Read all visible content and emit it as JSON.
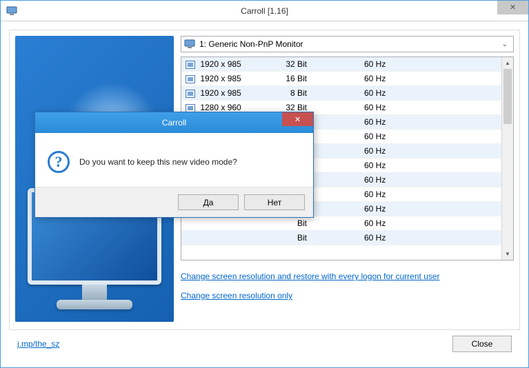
{
  "window": {
    "title": "Carroll [1.16]"
  },
  "monitor_select": {
    "selected": "1: Generic Non-PnP Monitor"
  },
  "resolutions": [
    {
      "res": "1920 x 985",
      "bit": "32 Bit",
      "hz": "60 Hz"
    },
    {
      "res": "1920 x 985",
      "bit": "16 Bit",
      "hz": "60 Hz"
    },
    {
      "res": "1920 x 985",
      "bit": "8 Bit",
      "hz": "60 Hz"
    },
    {
      "res": "1280 x 960",
      "bit": "32 Bit",
      "hz": "60 Hz"
    },
    {
      "res": "",
      "bit": "Bit",
      "hz": "60 Hz"
    },
    {
      "res": "",
      "bit": "Bit",
      "hz": "60 Hz"
    },
    {
      "res": "",
      "bit": "Bit",
      "hz": "60 Hz"
    },
    {
      "res": "",
      "bit": "Bit",
      "hz": "60 Hz"
    },
    {
      "res": "",
      "bit": "Bit",
      "hz": "60 Hz"
    },
    {
      "res": "",
      "bit": "Bit",
      "hz": "60 Hz"
    },
    {
      "res": "",
      "bit": "Bit",
      "hz": "60 Hz"
    },
    {
      "res": "",
      "bit": "Bit",
      "hz": "60 Hz"
    },
    {
      "res": "",
      "bit": "Bit",
      "hz": "60 Hz"
    }
  ],
  "links": {
    "change_restore": "Change screen resolution and restore with every logon for current user",
    "change_only": "Change screen resolution only"
  },
  "bottom": {
    "link": "j.mp/the_sz",
    "close": "Close"
  },
  "dialog": {
    "title": "Carroll",
    "message": "Do you want to keep this new video mode?",
    "yes": "Да",
    "no": "Нет"
  }
}
